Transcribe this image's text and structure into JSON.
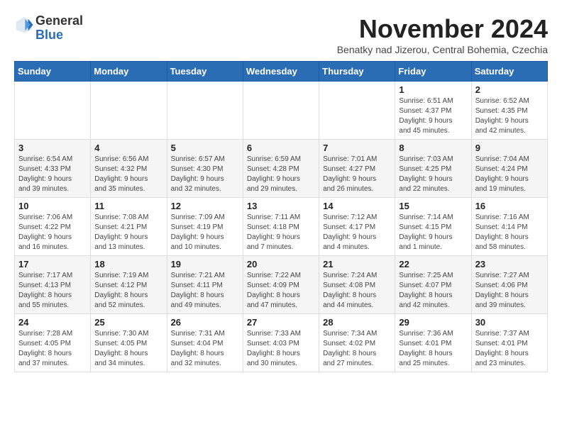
{
  "logo": {
    "general": "General",
    "blue": "Blue"
  },
  "header": {
    "month_title": "November 2024",
    "subtitle": "Benatky nad Jizerou, Central Bohemia, Czechia"
  },
  "columns": [
    "Sunday",
    "Monday",
    "Tuesday",
    "Wednesday",
    "Thursday",
    "Friday",
    "Saturday"
  ],
  "weeks": [
    [
      {
        "day": "",
        "info": ""
      },
      {
        "day": "",
        "info": ""
      },
      {
        "day": "",
        "info": ""
      },
      {
        "day": "",
        "info": ""
      },
      {
        "day": "",
        "info": ""
      },
      {
        "day": "1",
        "info": "Sunrise: 6:51 AM\nSunset: 4:37 PM\nDaylight: 9 hours\nand 45 minutes."
      },
      {
        "day": "2",
        "info": "Sunrise: 6:52 AM\nSunset: 4:35 PM\nDaylight: 9 hours\nand 42 minutes."
      }
    ],
    [
      {
        "day": "3",
        "info": "Sunrise: 6:54 AM\nSunset: 4:33 PM\nDaylight: 9 hours\nand 39 minutes."
      },
      {
        "day": "4",
        "info": "Sunrise: 6:56 AM\nSunset: 4:32 PM\nDaylight: 9 hours\nand 35 minutes."
      },
      {
        "day": "5",
        "info": "Sunrise: 6:57 AM\nSunset: 4:30 PM\nDaylight: 9 hours\nand 32 minutes."
      },
      {
        "day": "6",
        "info": "Sunrise: 6:59 AM\nSunset: 4:28 PM\nDaylight: 9 hours\nand 29 minutes."
      },
      {
        "day": "7",
        "info": "Sunrise: 7:01 AM\nSunset: 4:27 PM\nDaylight: 9 hours\nand 26 minutes."
      },
      {
        "day": "8",
        "info": "Sunrise: 7:03 AM\nSunset: 4:25 PM\nDaylight: 9 hours\nand 22 minutes."
      },
      {
        "day": "9",
        "info": "Sunrise: 7:04 AM\nSunset: 4:24 PM\nDaylight: 9 hours\nand 19 minutes."
      }
    ],
    [
      {
        "day": "10",
        "info": "Sunrise: 7:06 AM\nSunset: 4:22 PM\nDaylight: 9 hours\nand 16 minutes."
      },
      {
        "day": "11",
        "info": "Sunrise: 7:08 AM\nSunset: 4:21 PM\nDaylight: 9 hours\nand 13 minutes."
      },
      {
        "day": "12",
        "info": "Sunrise: 7:09 AM\nSunset: 4:19 PM\nDaylight: 9 hours\nand 10 minutes."
      },
      {
        "day": "13",
        "info": "Sunrise: 7:11 AM\nSunset: 4:18 PM\nDaylight: 9 hours\nand 7 minutes."
      },
      {
        "day": "14",
        "info": "Sunrise: 7:12 AM\nSunset: 4:17 PM\nDaylight: 9 hours\nand 4 minutes."
      },
      {
        "day": "15",
        "info": "Sunrise: 7:14 AM\nSunset: 4:15 PM\nDaylight: 9 hours\nand 1 minute."
      },
      {
        "day": "16",
        "info": "Sunrise: 7:16 AM\nSunset: 4:14 PM\nDaylight: 8 hours\nand 58 minutes."
      }
    ],
    [
      {
        "day": "17",
        "info": "Sunrise: 7:17 AM\nSunset: 4:13 PM\nDaylight: 8 hours\nand 55 minutes."
      },
      {
        "day": "18",
        "info": "Sunrise: 7:19 AM\nSunset: 4:12 PM\nDaylight: 8 hours\nand 52 minutes."
      },
      {
        "day": "19",
        "info": "Sunrise: 7:21 AM\nSunset: 4:11 PM\nDaylight: 8 hours\nand 49 minutes."
      },
      {
        "day": "20",
        "info": "Sunrise: 7:22 AM\nSunset: 4:09 PM\nDaylight: 8 hours\nand 47 minutes."
      },
      {
        "day": "21",
        "info": "Sunrise: 7:24 AM\nSunset: 4:08 PM\nDaylight: 8 hours\nand 44 minutes."
      },
      {
        "day": "22",
        "info": "Sunrise: 7:25 AM\nSunset: 4:07 PM\nDaylight: 8 hours\nand 42 minutes."
      },
      {
        "day": "23",
        "info": "Sunrise: 7:27 AM\nSunset: 4:06 PM\nDaylight: 8 hours\nand 39 minutes."
      }
    ],
    [
      {
        "day": "24",
        "info": "Sunrise: 7:28 AM\nSunset: 4:05 PM\nDaylight: 8 hours\nand 37 minutes."
      },
      {
        "day": "25",
        "info": "Sunrise: 7:30 AM\nSunset: 4:05 PM\nDaylight: 8 hours\nand 34 minutes."
      },
      {
        "day": "26",
        "info": "Sunrise: 7:31 AM\nSunset: 4:04 PM\nDaylight: 8 hours\nand 32 minutes."
      },
      {
        "day": "27",
        "info": "Sunrise: 7:33 AM\nSunset: 4:03 PM\nDaylight: 8 hours\nand 30 minutes."
      },
      {
        "day": "28",
        "info": "Sunrise: 7:34 AM\nSunset: 4:02 PM\nDaylight: 8 hours\nand 27 minutes."
      },
      {
        "day": "29",
        "info": "Sunrise: 7:36 AM\nSunset: 4:01 PM\nDaylight: 8 hours\nand 25 minutes."
      },
      {
        "day": "30",
        "info": "Sunrise: 7:37 AM\nSunset: 4:01 PM\nDaylight: 8 hours\nand 23 minutes."
      }
    ]
  ]
}
